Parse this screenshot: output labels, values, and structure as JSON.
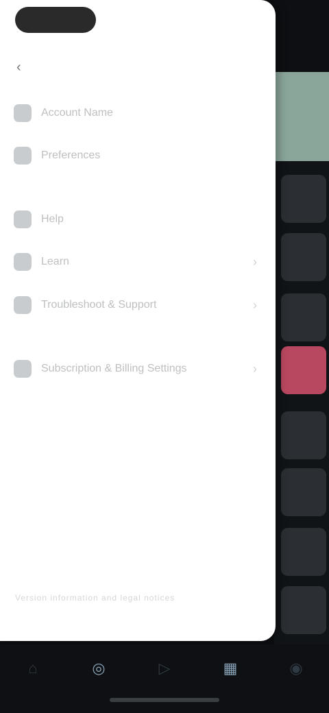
{
  "drawer": {
    "back_icon": "chevron-left-icon",
    "items": [
      {
        "label": "Account Name",
        "icon": "user-icon"
      },
      {
        "label": "Preferences",
        "icon": "settings-icon"
      },
      {
        "label": "Help",
        "icon": "help-icon"
      },
      {
        "label": "Learn",
        "icon": "book-icon"
      },
      {
        "label": "Troubleshoot & Support",
        "icon": "wrench-icon"
      },
      {
        "label": "Subscription & Billing Settings",
        "icon": "card-icon"
      }
    ],
    "footer": "Version information and legal notices"
  },
  "bottom_nav": {
    "items": [
      {
        "icon": "home-icon"
      },
      {
        "icon": "compass-icon"
      },
      {
        "icon": "play-icon"
      },
      {
        "icon": "grid-icon"
      },
      {
        "icon": "profile-icon"
      }
    ]
  },
  "colors": {
    "drawer_bg": "#ffffff",
    "accent_red": "#b8485f",
    "accent_green": "#8aa69a",
    "nav_bg": "#0e1013"
  }
}
